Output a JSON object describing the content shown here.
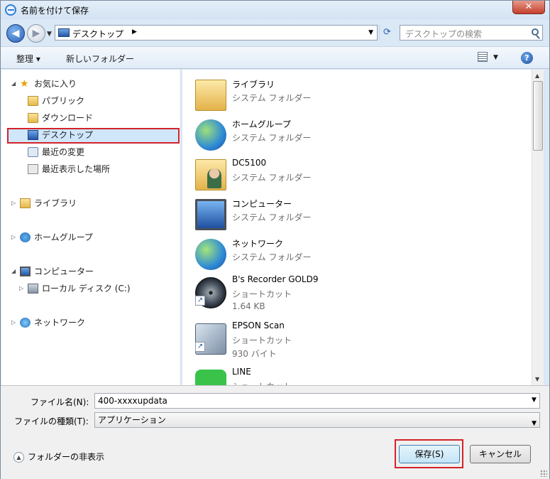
{
  "window": {
    "title": "名前を付けて保存",
    "close_label": "✕"
  },
  "nav": {
    "back_icon": "back-arrow-icon",
    "forward_icon": "forward-arrow-icon",
    "address": "デスクトップ",
    "search_placeholder": "デスクトップの検索"
  },
  "toolbar": {
    "organize_label": "整理 ▾",
    "new_folder_label": "新しいフォルダー",
    "help_label": "?"
  },
  "sidebar": {
    "favorites": "お気に入り",
    "public": "パブリック",
    "downloads": "ダウンロード",
    "desktop": "デスクトップ",
    "recent": "最近の変更",
    "recent_places": "最近表示した場所",
    "libraries": "ライブラリ",
    "homegroup": "ホームグループ",
    "computer": "コンピューター",
    "local_disk": "ローカル ディスク (C:)",
    "network": "ネットワーク"
  },
  "files": [
    {
      "name": "ライブラリ",
      "type": "システム フォルダー",
      "size": "",
      "icon": "library-icon"
    },
    {
      "name": "ホームグループ",
      "type": "システム フォルダー",
      "size": "",
      "icon": "homegroup-icon"
    },
    {
      "name": "DC5100",
      "type": "システム フォルダー",
      "size": "",
      "icon": "user-folder-icon"
    },
    {
      "name": "コンピューター",
      "type": "システム フォルダー",
      "size": "",
      "icon": "computer-icon"
    },
    {
      "name": "ネットワーク",
      "type": "システム フォルダー",
      "size": "",
      "icon": "network-icon"
    },
    {
      "name": "B's Recorder GOLD9",
      "type": "ショートカット",
      "size": "1.64 KB",
      "icon": "disc-icon"
    },
    {
      "name": "EPSON Scan",
      "type": "ショートカット",
      "size": "930 バイト",
      "icon": "scanner-icon"
    },
    {
      "name": "LINE",
      "type": "ショートカット",
      "size": "",
      "icon": "line-app-icon"
    }
  ],
  "form": {
    "filename_label": "ファイル名(N):",
    "filename_value": "400-xxxxupdata",
    "filetype_label": "ファイルの種類(T):",
    "filetype_value": "アプリケーション",
    "hide_folders_label": "フォルダーの非表示",
    "save_label": "保存(S)",
    "cancel_label": "キャンセル"
  }
}
